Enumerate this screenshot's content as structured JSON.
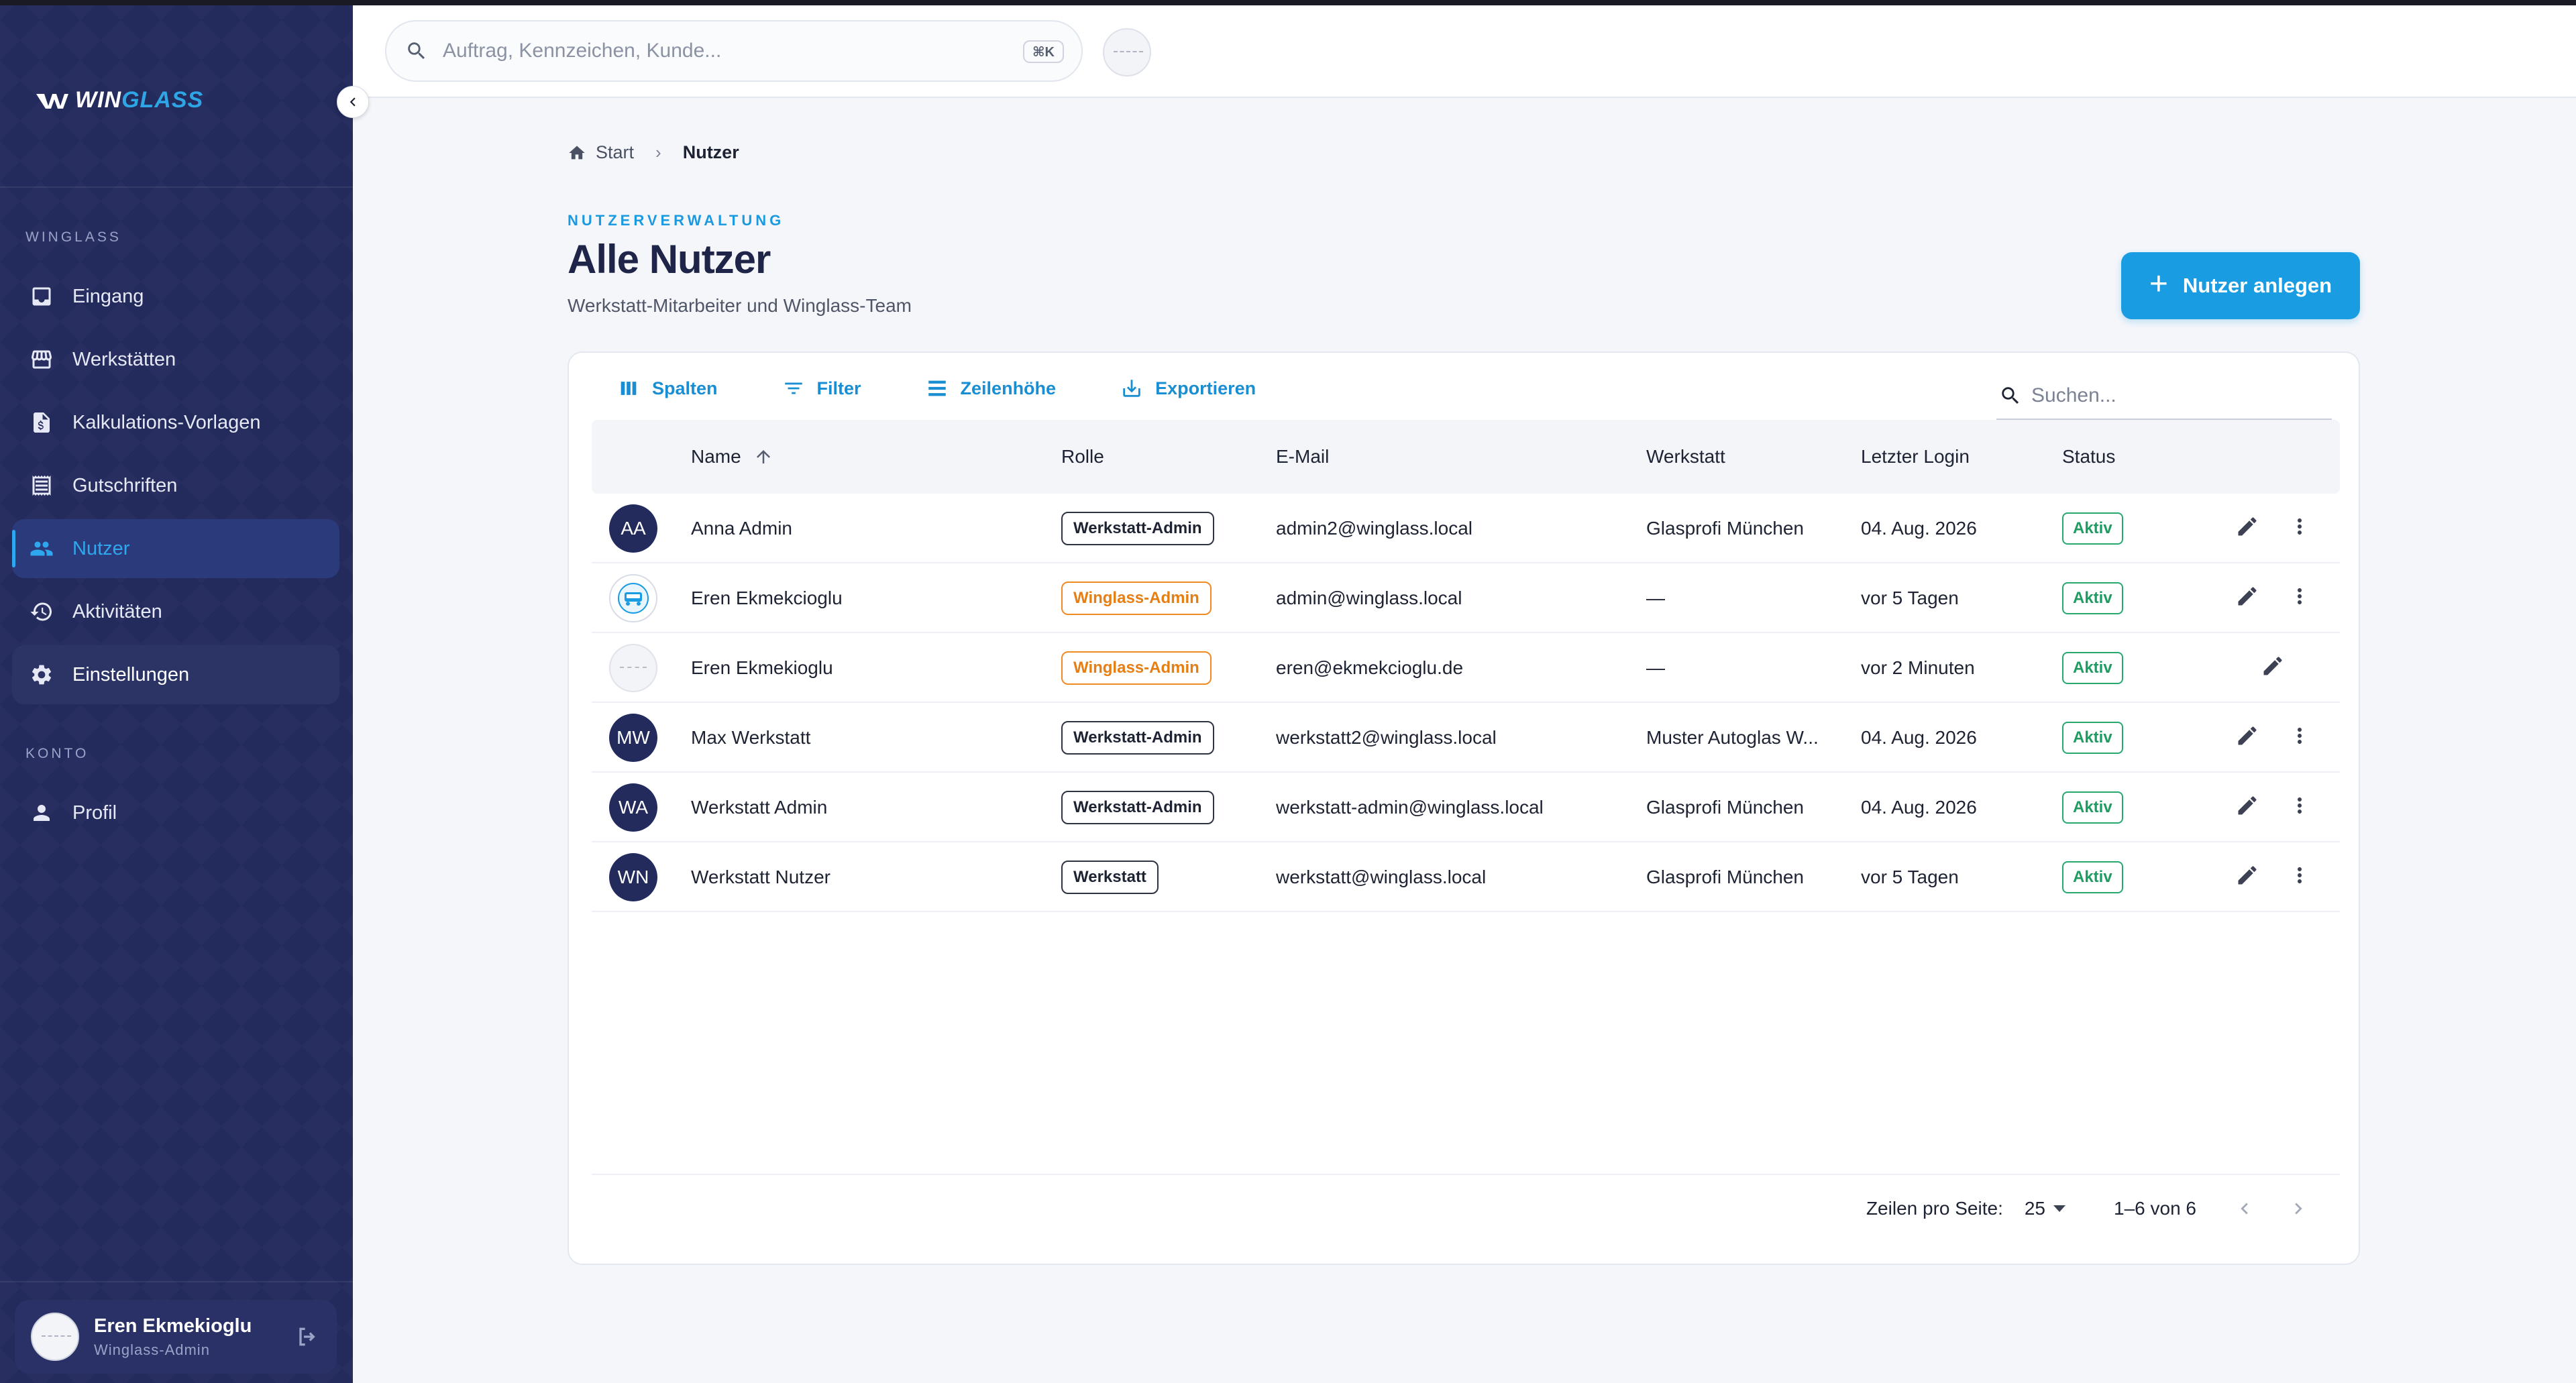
{
  "app": {
    "brand_left": "WIN",
    "brand_right": "GLASS"
  },
  "sidebar": {
    "section_main": "WINGLASS",
    "section_account": "KONTO",
    "items": [
      {
        "label": "Eingang",
        "icon": "inbox-icon"
      },
      {
        "label": "Werkstätten",
        "icon": "store-icon"
      },
      {
        "label": "Kalkulations-Vorlagen",
        "icon": "calculation-file-icon"
      },
      {
        "label": "Gutschriften",
        "icon": "receipt-icon"
      },
      {
        "label": "Nutzer",
        "icon": "users-icon",
        "active": true
      },
      {
        "label": "Aktivitäten",
        "icon": "history-icon"
      },
      {
        "label": "Einstellungen",
        "icon": "gear-icon"
      },
      {
        "label": "Profil",
        "icon": "person-icon"
      }
    ],
    "user": {
      "name": "Eren Ekmekioglu",
      "role": "Winglass-Admin"
    }
  },
  "topbar": {
    "search_placeholder": "Auftrag, Kennzeichen, Kunde...",
    "shortcut": "⌘K"
  },
  "breadcrumb": {
    "home": "Start",
    "current": "Nutzer"
  },
  "header": {
    "eyebrow": "NUTZERVERWALTUNG",
    "title": "Alle Nutzer",
    "subtitle": "Werkstatt-Mitarbeiter und Winglass-Team",
    "add_button": "Nutzer anlegen"
  },
  "toolbar": {
    "columns": "Spalten",
    "filter": "Filter",
    "density": "Zeilenhöhe",
    "export": "Exportieren",
    "search_placeholder": "Suchen..."
  },
  "table": {
    "columns": [
      "Name",
      "Rolle",
      "E-Mail",
      "Werkstatt",
      "Letzter Login",
      "Status"
    ],
    "sort": {
      "column": "Name",
      "direction": "ascending"
    },
    "rows": [
      {
        "initials": "AA",
        "avatar": "initials",
        "name": "Anna Admin",
        "role": "Werkstatt-Admin",
        "role_color": "dark",
        "email": "admin2@winglass.local",
        "workshop": "Glasprofi München",
        "last_login": "04. Aug. 2026",
        "status": "Aktiv",
        "menu": true
      },
      {
        "initials": "",
        "avatar": "image",
        "name": "Eren Ekmekcioglu",
        "role": "Winglass-Admin",
        "role_color": "orange",
        "email": "admin@winglass.local",
        "workshop": "—",
        "last_login": "vor 5 Tagen",
        "status": "Aktiv",
        "menu": true
      },
      {
        "initials": "",
        "avatar": "blank",
        "name": "Eren Ekmekioglu",
        "role": "Winglass-Admin",
        "role_color": "orange",
        "email": "eren@ekmekcioglu.de",
        "workshop": "—",
        "last_login": "vor 2 Minuten",
        "status": "Aktiv",
        "menu": false
      },
      {
        "initials": "MW",
        "avatar": "initials",
        "name": "Max Werkstatt",
        "role": "Werkstatt-Admin",
        "role_color": "dark",
        "email": "werkstatt2@winglass.local",
        "workshop": "Muster Autoglas W...",
        "last_login": "04. Aug. 2026",
        "status": "Aktiv",
        "menu": true
      },
      {
        "initials": "WA",
        "avatar": "initials",
        "name": "Werkstatt Admin",
        "role": "Werkstatt-Admin",
        "role_color": "dark",
        "email": "werkstatt-admin@winglass.local",
        "workshop": "Glasprofi München",
        "last_login": "04. Aug. 2026",
        "status": "Aktiv",
        "menu": true
      },
      {
        "initials": "WN",
        "avatar": "initials",
        "name": "Werkstatt Nutzer",
        "role": "Werkstatt",
        "role_color": "dark",
        "email": "werkstatt@winglass.local",
        "workshop": "Glasprofi München",
        "last_login": "vor 5 Tagen",
        "status": "Aktiv",
        "menu": true
      }
    ]
  },
  "pagination": {
    "rows_per_page_label": "Zeilen pro Seite:",
    "rows_per_page": "25",
    "range": "1–6 von 6"
  },
  "colors": {
    "sidebar": "#232a5c",
    "accent": "#1a9ce2",
    "status_active": "#1f9c61",
    "role_orange": "#e67e13"
  }
}
